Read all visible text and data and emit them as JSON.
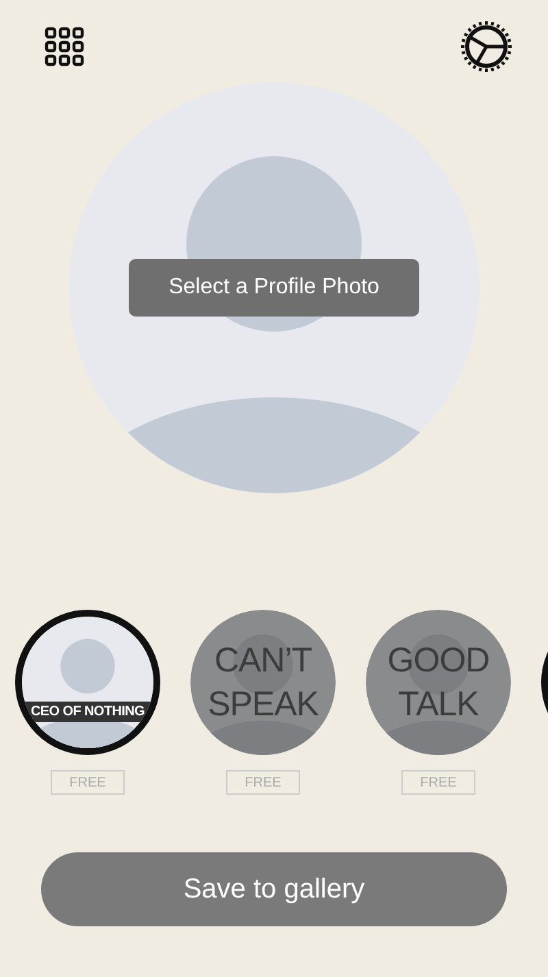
{
  "profile": {
    "prompt": "Select a Profile Photo"
  },
  "frames": [
    {
      "kind": "banner",
      "caption": "CEO OF NOTHING",
      "badge": "FREE"
    },
    {
      "kind": "overlay",
      "caption": "CAN’T SPEAK",
      "badge": "FREE"
    },
    {
      "kind": "overlay",
      "caption": "GOOD TALK",
      "badge": "FREE"
    },
    {
      "kind": "ring"
    }
  ],
  "save_button": "Save to gallery"
}
